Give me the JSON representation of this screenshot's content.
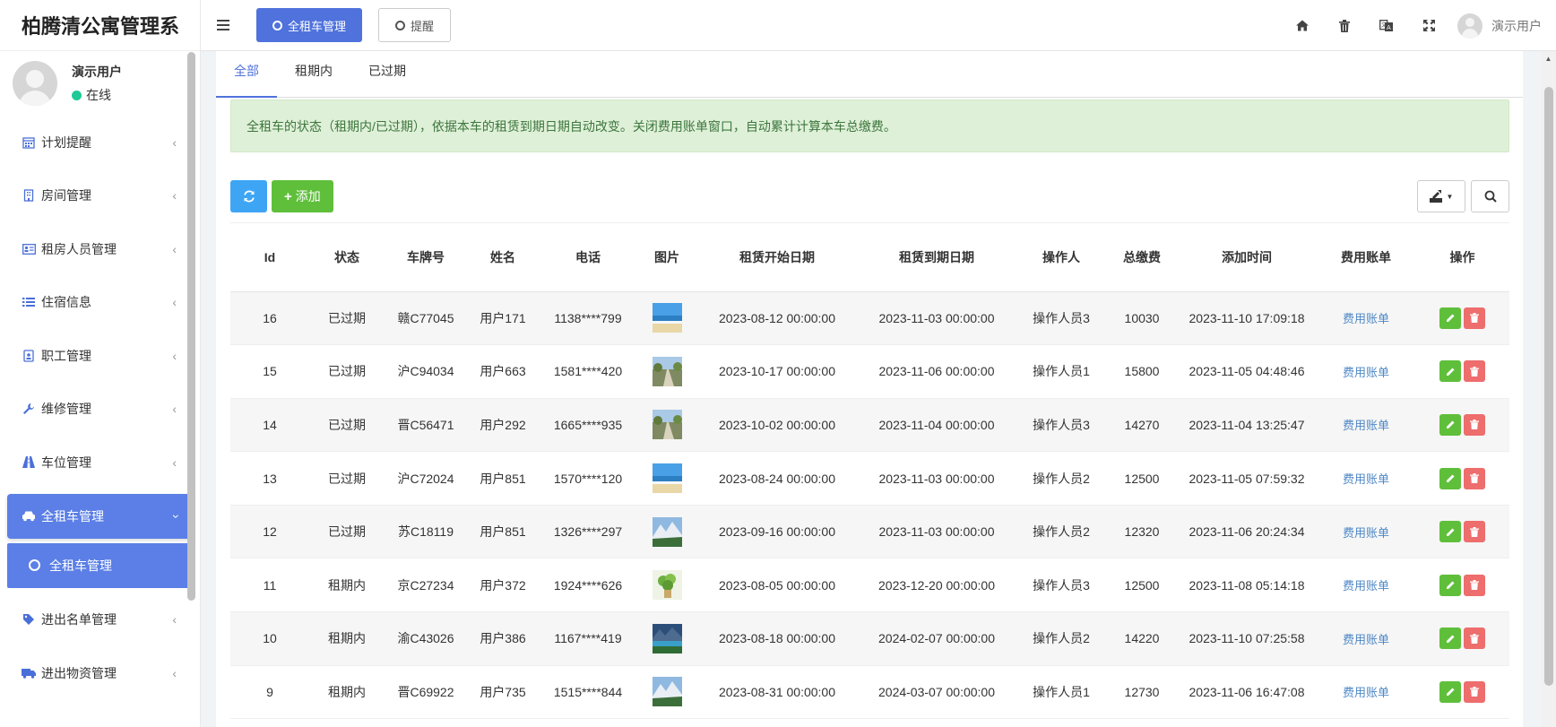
{
  "app": {
    "title": "柏腾清公寓管理系"
  },
  "user": {
    "name": "演示用户",
    "status": "在线"
  },
  "sidebar": {
    "items": [
      {
        "label": "计划提醒",
        "icon": "calendar-icon"
      },
      {
        "label": "房间管理",
        "icon": "building-icon"
      },
      {
        "label": "租房人员管理",
        "icon": "id-card-icon"
      },
      {
        "label": "住宿信息",
        "icon": "list-icon"
      },
      {
        "label": "职工管理",
        "icon": "id-badge-icon"
      },
      {
        "label": "维修管理",
        "icon": "wrench-icon"
      },
      {
        "label": "车位管理",
        "icon": "road-icon"
      },
      {
        "label": "全租车管理",
        "icon": "car-icon",
        "active": true
      },
      {
        "label": "进出名单管理",
        "icon": "tag-icon"
      },
      {
        "label": "进出物资管理",
        "icon": "truck-icon"
      }
    ],
    "submenu": {
      "label": "全租车管理"
    }
  },
  "topbar": {
    "tabs": [
      {
        "label": "全租车管理",
        "active": true
      },
      {
        "label": "提醒",
        "active": false
      }
    ],
    "user_label": "演示用户"
  },
  "subtabs": [
    "全部",
    "租期内",
    "已过期"
  ],
  "alert": "全租车的状态（租期内/已过期），依据本车的租赁到期日期自动改变。关闭费用账单窗口，自动累计计算本车总缴费。",
  "toolbar": {
    "add_label": "添加"
  },
  "table": {
    "headers": [
      "Id",
      "状态",
      "车牌号",
      "姓名",
      "电话",
      "图片",
      "租赁开始日期",
      "租赁到期日期",
      "操作人",
      "总缴费",
      "添加时间",
      "费用账单",
      "操作"
    ],
    "rows": [
      {
        "id": "16",
        "status": "已过期",
        "plate": "赣C77045",
        "name": "用户171",
        "phone": "1138****799",
        "image": "beach",
        "start": "2023-08-12 00:00:00",
        "end": "2023-11-03 00:00:00",
        "operator": "操作人员3",
        "total": "10030",
        "added": "2023-11-10 17:09:18",
        "bill": "费用账单"
      },
      {
        "id": "15",
        "status": "已过期",
        "plate": "沪C94034",
        "name": "用户663",
        "phone": "1581****420",
        "image": "road",
        "start": "2023-10-17 00:00:00",
        "end": "2023-11-06 00:00:00",
        "operator": "操作人员1",
        "total": "15800",
        "added": "2023-11-05 04:48:46",
        "bill": "费用账单"
      },
      {
        "id": "14",
        "status": "已过期",
        "plate": "晋C56471",
        "name": "用户292",
        "phone": "1665****935",
        "image": "road",
        "start": "2023-10-02 00:00:00",
        "end": "2023-11-04 00:00:00",
        "operator": "操作人员3",
        "total": "14270",
        "added": "2023-11-04 13:25:47",
        "bill": "费用账单"
      },
      {
        "id": "13",
        "status": "已过期",
        "plate": "沪C72024",
        "name": "用户851",
        "phone": "1570****120",
        "image": "beach",
        "start": "2023-08-24 00:00:00",
        "end": "2023-11-03 00:00:00",
        "operator": "操作人员2",
        "total": "12500",
        "added": "2023-11-05 07:59:32",
        "bill": "费用账单"
      },
      {
        "id": "12",
        "status": "已过期",
        "plate": "苏C18119",
        "name": "用户851",
        "phone": "1326****297",
        "image": "mountain",
        "start": "2023-09-16 00:00:00",
        "end": "2023-11-03 00:00:00",
        "operator": "操作人员2",
        "total": "12320",
        "added": "2023-11-06 20:24:34",
        "bill": "费用账单"
      },
      {
        "id": "11",
        "status": "租期内",
        "plate": "京C27234",
        "name": "用户372",
        "phone": "1924****626",
        "image": "plant",
        "start": "2023-08-05 00:00:00",
        "end": "2023-12-20 00:00:00",
        "operator": "操作人员3",
        "total": "12500",
        "added": "2023-11-08 05:14:18",
        "bill": "费用账单"
      },
      {
        "id": "10",
        "status": "租期内",
        "plate": "渝C43026",
        "name": "用户386",
        "phone": "1167****419",
        "image": "lake",
        "start": "2023-08-18 00:00:00",
        "end": "2024-02-07 00:00:00",
        "operator": "操作人员2",
        "total": "14220",
        "added": "2023-11-10 07:25:58",
        "bill": "费用账单"
      },
      {
        "id": "9",
        "status": "租期内",
        "plate": "晋C69922",
        "name": "用户735",
        "phone": "1515****844",
        "image": "mountain",
        "start": "2023-08-31 00:00:00",
        "end": "2024-03-07 00:00:00",
        "operator": "操作人员1",
        "total": "12730",
        "added": "2023-11-06 16:47:08",
        "bill": "费用账单"
      }
    ]
  },
  "colors": {
    "primary": "#4f72dc",
    "success": "#5fbf3b",
    "danger": "#ee6d6d",
    "info": "#3ea5f5",
    "alert_bg": "#dff0d8",
    "alert_text": "#3c763d",
    "online": "#20c997"
  }
}
